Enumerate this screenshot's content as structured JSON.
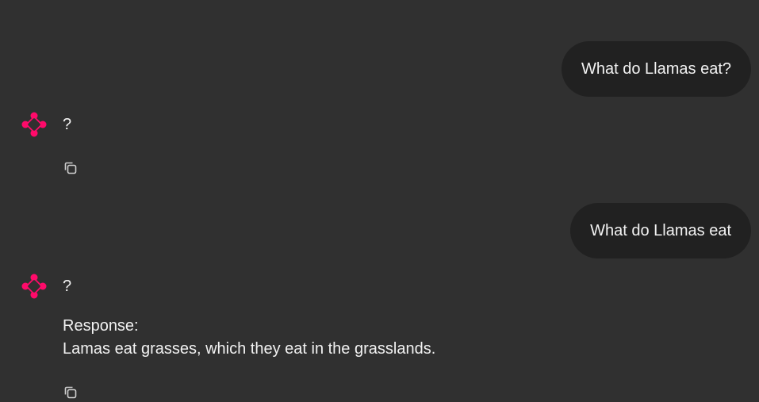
{
  "messages": [
    {
      "role": "user",
      "text": "What do Llamas eat?"
    },
    {
      "role": "assistant",
      "text": "?",
      "action_icon": "copy-icon"
    },
    {
      "role": "user",
      "text": "What do Llamas eat"
    },
    {
      "role": "assistant",
      "text": "?",
      "response_heading": "Response:",
      "response_body": "Lamas eat grasses, which they eat in the grasslands.",
      "action_icon": "copy-icon"
    }
  ],
  "colors": {
    "background": "#303030",
    "user_bubble": "#212121",
    "text": "#f2f2f2",
    "avatar_accent": "#ff0a6a",
    "icon": "#cfcfcf"
  }
}
